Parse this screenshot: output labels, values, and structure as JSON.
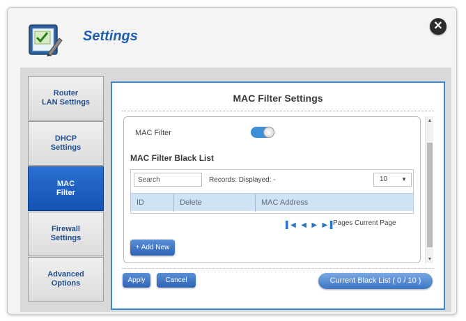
{
  "header": {
    "title": "Settings",
    "icon": "settings-clipboard-icon",
    "close_icon": "close-icon"
  },
  "sidebar": {
    "items": [
      {
        "label": "Router\nLAN Settings",
        "active": false
      },
      {
        "label": "DHCP\nSettings",
        "active": false
      },
      {
        "label": "MAC\nFilter",
        "active": true
      },
      {
        "label": "Firewall\nSettings",
        "active": false
      },
      {
        "label": "Advanced\nOptions",
        "active": false
      }
    ]
  },
  "main": {
    "title": "MAC Filter Settings",
    "mac_filter_label": "MAC Filter",
    "mac_filter_enabled": true,
    "section_title": "MAC Filter Black List",
    "search_placeholder": "Search",
    "records_label": "Records:  Displayed: -",
    "records_per_page": "10",
    "table_headers": [
      "ID",
      "Delete",
      "MAC Address"
    ],
    "pages_label": "Pages  Current Page",
    "add_new_label": "+ Add New",
    "apply_label": "Apply",
    "cancel_label": "Cancel",
    "blacklist_label": "Current Black List ( 0 / 10 )"
  },
  "colors": {
    "accent": "#1f5fb0",
    "active_tab": "#1452b3",
    "panel_border": "#3a8ad3",
    "button": "#2e63b6"
  }
}
